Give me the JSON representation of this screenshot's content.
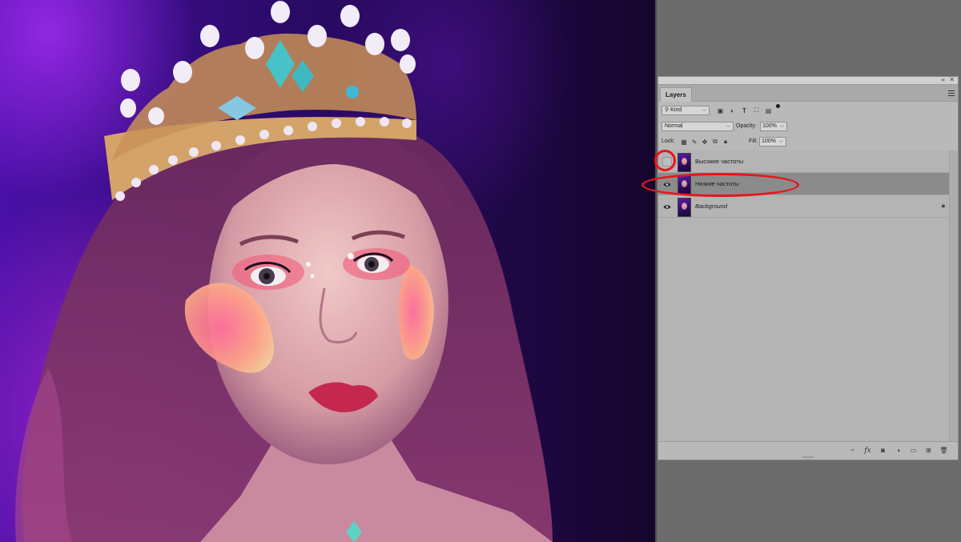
{
  "panel": {
    "tab_label": "Layers",
    "filter": {
      "kind_label": "Kind"
    },
    "blend_mode": "Normal",
    "opacity_label": "Opacity:",
    "opacity_value": "100%",
    "lock_label": "Lock:",
    "fill_label": "Fill:",
    "fill_value": "100%",
    "layers": [
      {
        "name": "Высокие частоты",
        "visible": false,
        "selected": false,
        "locked": false
      },
      {
        "name": "Низкие частоты",
        "visible": true,
        "selected": true,
        "locked": false
      },
      {
        "name": "Background",
        "visible": true,
        "selected": false,
        "locked": true
      }
    ]
  },
  "annotation_color": "#e8141c",
  "icons": {
    "filter": [
      "image-filter-icon",
      "adjustment-filter-icon",
      "type-filter-icon",
      "shape-filter-icon",
      "smart-object-filter-icon"
    ],
    "lock": [
      "lock-transparent-icon",
      "lock-image-icon",
      "lock-position-icon",
      "lock-artboard-icon",
      "lock-all-icon"
    ],
    "footer": [
      "link-layers-icon",
      "fx-icon",
      "add-mask-icon",
      "adjustment-layer-icon",
      "new-group-icon",
      "new-layer-icon",
      "delete-layer-icon"
    ]
  }
}
